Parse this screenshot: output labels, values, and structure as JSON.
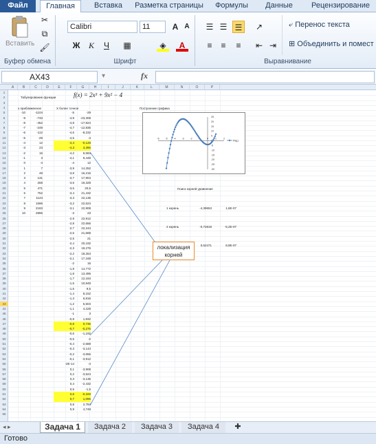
{
  "tabs": {
    "file": "Файл",
    "home": "Главная",
    "insert": "Вставка",
    "layout": "Разметка страницы",
    "formulas": "Формулы",
    "data": "Данные",
    "review": "Рецензирование"
  },
  "ribbon": {
    "paste_label": "Вставить",
    "clipboard_label": "Буфер обмена",
    "font_name": "Calibri",
    "font_size": "11",
    "font_label": "Шрифт",
    "bold": "Ж",
    "italic": "К",
    "underline": "Ч",
    "wrap_text": "Перенос текста",
    "merge": "Объединить и помест",
    "align_label": "Выравнивание"
  },
  "formula_bar": {
    "name_box": "AX43",
    "fx": "fx",
    "value": ""
  },
  "sheet": {
    "columns": [
      "A",
      "B",
      "C",
      "D",
      "E",
      "F",
      "G",
      "H",
      "I",
      "J",
      "K",
      "L",
      "M",
      "N",
      "O",
      "P"
    ],
    "title": "Табулирование функции",
    "formula_text": "f(x) = 2x³ + 9x² − 4",
    "col_b_header": "x приближенное",
    "col_e_header": "X более точное",
    "chart_title": "Построение графика",
    "legend": "Ряд1",
    "roots_title": "Поиск корней уравнения",
    "roots": [
      {
        "label": "1 корень",
        "x": "-4,39653",
        "f": "1,6Е-07"
      },
      {
        "label": "2 корень",
        "x": "-0,72818",
        "f": "-5,2Е-07"
      },
      {
        "label": "3 корень",
        "x": "0,62471",
        "f": "8,9Е-07"
      }
    ],
    "left_table": [
      [
        "-10",
        "-1104"
      ],
      [
        "-9",
        "-733"
      ],
      [
        "-8",
        "-452"
      ],
      [
        "-7",
        "-249"
      ],
      [
        "-6",
        "-112"
      ],
      [
        "-5",
        "-29"
      ],
      [
        "-4",
        "12"
      ],
      [
        "-3",
        "23"
      ],
      [
        "-2",
        "16"
      ],
      [
        "-1",
        "3"
      ],
      [
        "0",
        "-4"
      ],
      [
        "1",
        "7"
      ],
      [
        "2",
        "48"
      ],
      [
        "3",
        "131"
      ],
      [
        "4",
        "268"
      ],
      [
        "5",
        "471"
      ],
      [
        "6",
        "752"
      ],
      [
        "7",
        "1123"
      ],
      [
        "8",
        "1596"
      ],
      [
        "9",
        "2183"
      ],
      [
        "10",
        "2896"
      ]
    ],
    "right_table": [
      [
        "-5",
        "-29"
      ],
      [
        "-4,9",
        "-23,308"
      ],
      [
        "-4,8",
        "-17,824"
      ],
      [
        "-4,7",
        "-12,836"
      ],
      [
        "-4,6",
        "-8,232"
      ],
      [
        "-4,5",
        "-4"
      ],
      [
        "-4,4",
        "-0,128",
        true
      ],
      [
        "-4,3",
        "3,396",
        true
      ],
      [
        "-4,2",
        "6,584"
      ],
      [
        "-4,1",
        "9,448"
      ],
      [
        "-4",
        "12"
      ],
      [
        "-3,9",
        "14,252"
      ],
      [
        "-3,8",
        "16,216"
      ],
      [
        "-3,7",
        "17,904"
      ],
      [
        "-3,6",
        "19,328"
      ],
      [
        "-3,5",
        "20,5"
      ],
      [
        "-3,4",
        "21,432"
      ],
      [
        "-3,3",
        "22,136"
      ],
      [
        "-3,2",
        "22,624"
      ],
      [
        "-3,1",
        "22,908"
      ],
      [
        "-3",
        "23"
      ],
      [
        "-2,9",
        "22,912"
      ],
      [
        "-2,8",
        "22,656"
      ],
      [
        "-2,7",
        "22,244"
      ],
      [
        "-2,6",
        "21,688"
      ],
      [
        "-2,5",
        "21"
      ],
      [
        "-2,4",
        "20,192"
      ],
      [
        "-2,3",
        "19,276"
      ],
      [
        "-2,2",
        "18,264"
      ],
      [
        "-2,1",
        "17,168"
      ],
      [
        "-2",
        "16"
      ],
      [
        "-1,9",
        "14,772"
      ],
      [
        "-1,8",
        "13,496"
      ],
      [
        "-1,7",
        "12,184"
      ],
      [
        "-1,6",
        "10,848"
      ],
      [
        "-1,5",
        "9,5"
      ],
      [
        "-1,4",
        "8,152"
      ],
      [
        "-1,3",
        "6,816"
      ],
      [
        "-1,2",
        "5,504"
      ],
      [
        "-1,1",
        "4,228"
      ],
      [
        "-1",
        "3"
      ],
      [
        "-0,9",
        "1,832"
      ],
      [
        "-0,8",
        "0,736",
        true
      ],
      [
        "-0,7",
        "-0,276",
        true
      ],
      [
        "-0,6",
        "-1,192"
      ],
      [
        "-0,5",
        "-2"
      ],
      [
        "-0,4",
        "-2,688"
      ],
      [
        "-0,3",
        "-3,144"
      ],
      [
        "-0,2",
        "-3,656"
      ],
      [
        "-0,1",
        "-3,912"
      ],
      [
        "-2E-14",
        "-4"
      ],
      [
        "0,1",
        "-3,908"
      ],
      [
        "0,2",
        "-3,624"
      ],
      [
        "0,3",
        "-3,136"
      ],
      [
        "0,4",
        "-2,432"
      ],
      [
        "0,5",
        "-1,5"
      ],
      [
        "0,6",
        "-0,328",
        true
      ],
      [
        "0,7",
        "1,096",
        true
      ],
      [
        "0,8",
        "2,784"
      ],
      [
        "0,9",
        "4,748"
      ]
    ],
    "callout": "локализация корней"
  },
  "chart_data": {
    "type": "line",
    "title": "",
    "x": [
      -5,
      -4.9,
      -4.8,
      -4.7,
      -4.6,
      -4.5,
      -4.4,
      -4.3,
      -4.2,
      -4.1,
      -4,
      -3.9,
      -3.8,
      -3.7,
      -3.6,
      -3.5,
      -3.4,
      -3.3,
      -3.2,
      -3.1,
      -3,
      -2.9,
      -2.8,
      -2.7,
      -2.6,
      -2.5,
      -2.4,
      -2.3,
      -2.2,
      -2.1,
      -2,
      -1.9,
      -1.8,
      -1.7,
      -1.6,
      -1.5,
      -1.4,
      -1.3,
      -1.2,
      -1.1,
      -1,
      -0.9,
      -0.8,
      -0.7,
      -0.6,
      -0.5,
      -0.4,
      -0.3,
      -0.2,
      -0.1,
      0,
      0.1,
      0.2,
      0.3,
      0.4,
      0.5,
      0.6,
      0.7,
      0.8,
      0.9,
      1
    ],
    "series": [
      {
        "name": "Ряд1",
        "values": [
          -29,
          -23.308,
          -17.824,
          -12.836,
          -8.232,
          -4,
          -0.128,
          3.396,
          6.584,
          9.448,
          12,
          14.252,
          16.216,
          17.904,
          19.328,
          20.5,
          21.432,
          22.136,
          22.624,
          22.908,
          23,
          22.912,
          22.656,
          22.244,
          21.688,
          21,
          20.192,
          19.276,
          18.264,
          17.168,
          16,
          14.772,
          13.496,
          12.184,
          10.848,
          9.5,
          8.152,
          6.816,
          5.504,
          4.228,
          3,
          1.832,
          0.736,
          -0.276,
          -1.192,
          -2,
          -2.688,
          -3.144,
          -3.656,
          -3.912,
          -4,
          -3.908,
          -3.624,
          -3.136,
          -2.432,
          -1.5,
          -0.328,
          1.096,
          2.784,
          4.748,
          7
        ]
      }
    ],
    "xlim": [
      -6,
      2
    ],
    "ylim": [
      -30,
      25
    ],
    "x_ticks": [
      "-6",
      "-5",
      "-4",
      "-3",
      "-2",
      "-1",
      "0",
      "1",
      "2"
    ],
    "y_ticks": [
      "25",
      "20",
      "15",
      "10",
      "5",
      "0",
      "-5",
      "-10",
      "-15",
      "-20",
      "-25",
      "-30"
    ],
    "color": "#4a7ebb",
    "legend": "right"
  },
  "sheet_tabs": [
    "Задача 1",
    "Задача 2",
    "Задача 3",
    "Задача 4"
  ],
  "status": "Готово"
}
